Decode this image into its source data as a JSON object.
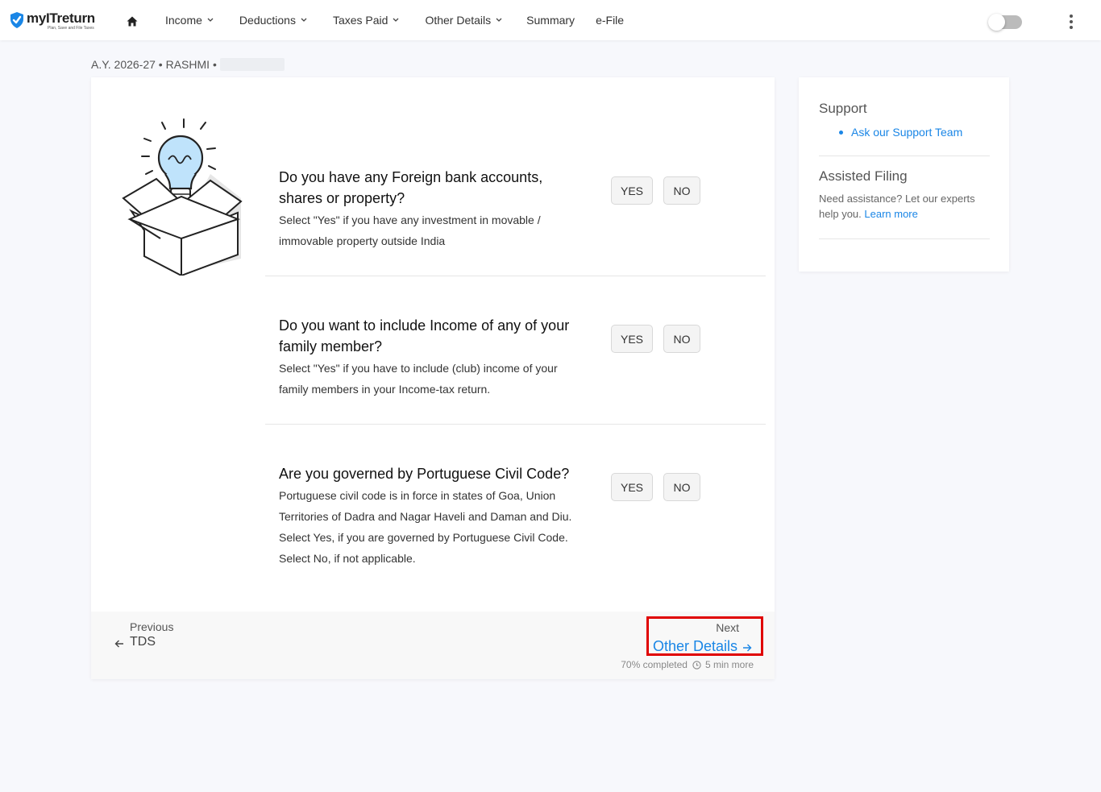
{
  "header": {
    "logo_name": "myITreturn",
    "logo_tagline": "Plan, Save and File Taxes",
    "nav": [
      {
        "label": "Income",
        "has_dropdown": true
      },
      {
        "label": "Deductions",
        "has_dropdown": true
      },
      {
        "label": "Taxes Paid",
        "has_dropdown": true
      },
      {
        "label": "Other Details",
        "has_dropdown": true
      },
      {
        "label": "Summary",
        "has_dropdown": false
      },
      {
        "label": "e-File",
        "has_dropdown": false
      }
    ],
    "toggle_state": "off"
  },
  "context": {
    "text": "A.Y. 2026-27 • RASHMI •"
  },
  "questions": [
    {
      "title": "Do you have any Foreign bank accounts, shares or property?",
      "description": "Select \"Yes\" if you have any investment in movable / immovable property outside India",
      "yes_label": "YES",
      "no_label": "NO"
    },
    {
      "title": "Do you want to include Income of any of your family member?",
      "description": "Select \"Yes\" if you have to include (club) income of your family members in your Income-tax return.",
      "yes_label": "YES",
      "no_label": "NO"
    },
    {
      "title": "Are you governed by Portuguese Civil Code?",
      "description": "Portuguese civil code is in force in states of Goa, Union Territories of Dadra and Nagar Haveli and Daman and Diu. Select Yes, if you are governed by Portuguese Civil Code. Select No, if not applicable.",
      "yes_label": "YES",
      "no_label": "NO"
    }
  ],
  "footer": {
    "previous_caption": "Previous",
    "previous_name": "TDS",
    "next_caption": "Next",
    "next_name": "Other Details",
    "progress_text": "70% completed",
    "time_text": "5 min more"
  },
  "sidebar": {
    "support_title": "Support",
    "support_link": "Ask our Support Team",
    "assisted_title": "Assisted Filing",
    "assisted_desc": "Need assistance? Let our experts help you.",
    "learn_more": "Learn more"
  },
  "colors": {
    "accent": "#1a86e6",
    "highlight_border": "#e00000",
    "background": "#f7f8fc"
  }
}
